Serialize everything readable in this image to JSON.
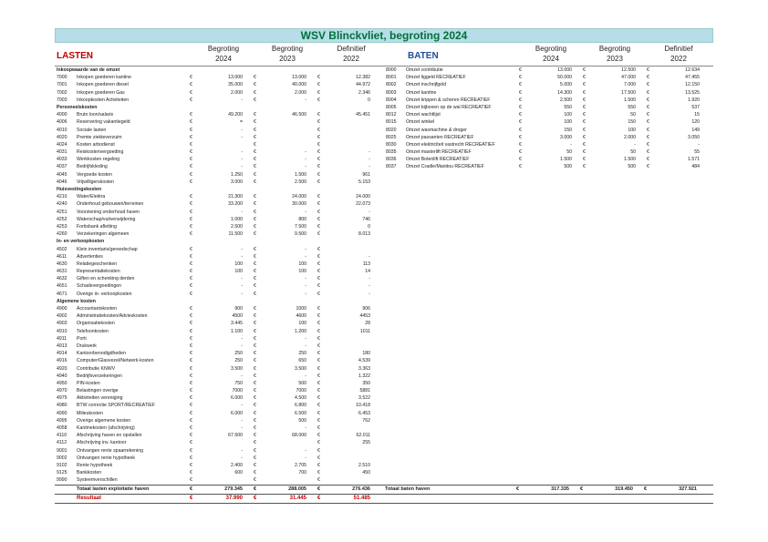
{
  "title": "WSV Blinckvliet, begroting 2024",
  "lasten_header": "LASTEN",
  "baten_header": "BATEN",
  "col_headers": [
    {
      "a": "Begroting",
      "b": "2024"
    },
    {
      "a": "Begroting",
      "b": "2023"
    },
    {
      "a": "Definitief",
      "b": "2022"
    }
  ],
  "euro": "€",
  "lasten": [
    {
      "code": "",
      "label": "Inkoopwaarde van de omzet",
      "cat": true
    },
    {
      "code": "7000",
      "label": "Inkopen goederen kantine",
      "v": [
        "13.000",
        "13.000",
        "12.382"
      ]
    },
    {
      "code": "7001",
      "label": "Inkopen goederen diesel",
      "v": [
        "35.000",
        "40.000",
        "44.972"
      ]
    },
    {
      "code": "7002",
      "label": "Inkopen goederen Gas",
      "v": [
        "2.000",
        "2.000",
        "2.346"
      ]
    },
    {
      "code": "7003",
      "label": "Inkoopkosten Activiteiten",
      "v": [
        "-",
        "-",
        "0"
      ]
    },
    {
      "code": "",
      "label": "Personeelskosten",
      "cat": true
    },
    {
      "code": "4000",
      "label": "Bruto loon/salaris",
      "v": [
        "49.200",
        "46.500",
        "45.451"
      ]
    },
    {
      "code": "4006",
      "label": "Reservering vakantiegeld",
      "v": [
        "=",
        "",
        ""
      ]
    },
    {
      "code": "4010",
      "label": "Sociale lasten",
      "v": [
        "-",
        "",
        ""
      ]
    },
    {
      "code": "4020",
      "label": "Premie ziekteverzuim",
      "v": [
        "-",
        "",
        ""
      ]
    },
    {
      "code": "4024",
      "label": "Kosten arbodienst",
      "v": [
        "",
        "",
        ""
      ]
    },
    {
      "code": "4031",
      "label": "Reiskostenvergoeding",
      "v": [
        "-",
        "-",
        "-"
      ]
    },
    {
      "code": "4033",
      "label": "Werkkosten regeling",
      "v": [
        "-",
        "-",
        "-"
      ]
    },
    {
      "code": "4037",
      "label": "Bedrijfskleding",
      "v": [
        "-",
        "-",
        "-"
      ]
    },
    {
      "code": "4045",
      "label": "Vergoede kosten",
      "v": [
        "1.250",
        "1.500",
        "961"
      ]
    },
    {
      "code": "4046",
      "label": "Vrijwilligerskosten",
      "v": [
        "3.000",
        "2.500",
        "5.153"
      ]
    },
    {
      "code": "",
      "label": "Huisvestingskosten",
      "cat": true
    },
    {
      "code": "4210",
      "label": "Water/Elektra",
      "v": [
        "21.300",
        "24.000",
        "24.000"
      ]
    },
    {
      "code": "4240",
      "label": "Onderhoud gebouwen/terreinen",
      "v": [
        "33.200",
        "30.000",
        "22.073"
      ]
    },
    {
      "code": "4251",
      "label": "Voorziening onderhoud haven",
      "v": [
        "-",
        "-",
        "-"
      ]
    },
    {
      "code": "4252",
      "label": "Waterschap/vuilverwijdering",
      "v": [
        "1.000",
        "800",
        "746"
      ]
    },
    {
      "code": "4253",
      "label": "Fortisbank afletting",
      "v": [
        "2.500",
        "7.500",
        "0"
      ]
    },
    {
      "code": "4260",
      "label": "Verzekeringen algemeen",
      "v": [
        "11.500",
        "9.500",
        "8.013"
      ]
    },
    {
      "code": "",
      "label": "In- en verkoopkosten",
      "cat": true
    },
    {
      "code": "4502",
      "label": "Klein inventaris/gereedschap",
      "v": [
        "-",
        "-",
        ""
      ]
    },
    {
      "code": "4611",
      "label": "Advertenties",
      "v": [
        "-",
        "-",
        "-"
      ]
    },
    {
      "code": "4630",
      "label": "Relatiegeschenken",
      "v": [
        "100",
        "100",
        "113"
      ]
    },
    {
      "code": "4631",
      "label": "Representatiekosten",
      "v": [
        "100",
        "100",
        "14"
      ]
    },
    {
      "code": "4632",
      "label": "Giften en schenking derden",
      "v": [
        "-",
        "-",
        "-"
      ]
    },
    {
      "code": "4651",
      "label": "Schadevergoedingen",
      "v": [
        "-",
        "-",
        "-"
      ]
    },
    {
      "code": "4671",
      "label": "Overige in- verkoopkosten",
      "v": [
        "-",
        "-",
        "-"
      ]
    },
    {
      "code": "",
      "label": "Algemene kosten",
      "cat": true
    },
    {
      "code": "4900",
      "label": "Accountantskosten",
      "v": [
        "900",
        "1000",
        "906"
      ]
    },
    {
      "code": "4902",
      "label": "Administratiekosten/Advieskosten",
      "v": [
        "4500",
        "4600",
        "4453"
      ]
    },
    {
      "code": "4903",
      "label": "Organisatiekosten",
      "v": [
        "3.445",
        "100",
        "28"
      ]
    },
    {
      "code": "4910",
      "label": "Telefoonkosten",
      "v": [
        "1.100",
        "1.200",
        "1011"
      ]
    },
    {
      "code": "4911",
      "label": "Porti",
      "v": [
        "-",
        "-",
        ""
      ]
    },
    {
      "code": "4913",
      "label": "Drukwerk",
      "v": [
        "-",
        "-",
        ""
      ]
    },
    {
      "code": "4914",
      "label": "Kantoorbenodigdheden",
      "v": [
        "250",
        "250",
        "180"
      ]
    },
    {
      "code": "4916",
      "label": "Computer/Glasvezel/Netwerk-kosten",
      "v": [
        "250",
        "650",
        "4.539"
      ]
    },
    {
      "code": "4920",
      "label": "Contributie KNWV",
      "v": [
        "3.500",
        "3.500",
        "3.363"
      ]
    },
    {
      "code": "4940",
      "label": "Bedrijfsverzekeringen",
      "v": [
        "-",
        "-",
        "1.322"
      ]
    },
    {
      "code": "4950",
      "label": "PIN-kosten",
      "v": [
        "750",
        "500",
        "350"
      ]
    },
    {
      "code": "4970",
      "label": "Belastingen overige",
      "v": [
        "7000",
        "7000",
        "5881"
      ]
    },
    {
      "code": "4975",
      "label": "Aktiviteiten vereniging",
      "v": [
        "6.000",
        "4.500",
        "3.522"
      ]
    },
    {
      "code": "4980",
      "label": "BTW correctie SPORT/RECREATIEF",
      "v": [
        "-",
        "6.800",
        "10.418"
      ]
    },
    {
      "code": "4990",
      "label": "Milieukosten",
      "v": [
        "6.000",
        "6.500",
        "6.453"
      ]
    },
    {
      "code": "4995",
      "label": "Overige algemene kosten",
      "v": [
        "-",
        "500",
        "762"
      ]
    },
    {
      "code": "4058",
      "label": "Kantinekosten (afschrijving)",
      "v": [
        "-",
        "-",
        ""
      ]
    },
    {
      "code": "4110",
      "label": "Afschrijving haven en opstallen",
      "v": [
        "67.500",
        "68.000",
        "62.011"
      ]
    },
    {
      "code": "4112",
      "label": "Afschrijving inv. kantoor",
      "v": [
        "",
        "",
        "255"
      ]
    },
    {
      "code": "9001",
      "label": "Ontvangen rente spaarrekening",
      "v": [
        "-",
        "-",
        ""
      ]
    },
    {
      "code": "9002",
      "label": "Ontvangen rente hypotheek",
      "v": [
        "-",
        "-",
        ""
      ]
    },
    {
      "code": "9102",
      "label": "Rente hypotheek",
      "v": [
        "2.400",
        "2.705",
        "2.510"
      ]
    },
    {
      "code": "9125",
      "label": "Bankkosten",
      "v": [
        "600",
        "700",
        "450"
      ]
    },
    {
      "code": "9990",
      "label": "Systeemverschillen",
      "v": [
        "",
        "",
        ""
      ]
    }
  ],
  "baten": [
    {
      "code": "8000",
      "label": "Omzet contributie",
      "v": [
        "13.000",
        "12.500",
        "12.634"
      ]
    },
    {
      "code": "8001",
      "label": "Omzet liggeld RECREATIEF",
      "v": [
        "50.000",
        "47.000",
        "47.455"
      ]
    },
    {
      "code": "8002",
      "label": "Omzet inschrijfgeld",
      "v": [
        "5.000",
        "7.000",
        "12.150"
      ]
    },
    {
      "code": "8003",
      "label": "Omzet kantine",
      "v": [
        "14.300",
        "17.500",
        "13.525"
      ]
    },
    {
      "code": "8004",
      "label": "Omzet krippen & scheren RECREATIEF",
      "v": [
        "2.500",
        "1.500",
        "1.920"
      ]
    },
    {
      "code": "8005",
      "label": "Omzet bijboxen op de wal RECREATIEF",
      "v": [
        "550",
        "550",
        "537"
      ]
    },
    {
      "code": "8012",
      "label": "Omzet wachtlijst",
      "v": [
        "100",
        "50",
        "15"
      ]
    },
    {
      "code": "8015",
      "label": "Omzet winkel",
      "v": [
        "100",
        "150",
        "120"
      ]
    },
    {
      "code": "8020",
      "label": "Omzet wasmachine & droger",
      "v": [
        "150",
        "100",
        "149"
      ]
    },
    {
      "code": "8025",
      "label": "Omzet passanten RECREATIEF",
      "v": [
        "3.000",
        "2.000",
        "3.050"
      ]
    },
    {
      "code": "8030",
      "label": "Omzet elektriciteit vastrecht RECREATIEF",
      "v": [
        "-",
        "-",
        "-"
      ]
    },
    {
      "code": "8035",
      "label": "Omzet masterlift RECREATIEF",
      "v": [
        "50",
        "50",
        "55"
      ]
    },
    {
      "code": "8036",
      "label": "Omzet Botenlift RECREATIEF",
      "v": [
        "1.500",
        "1.500",
        "1.571"
      ]
    },
    {
      "code": "8037",
      "label": "Omzet Cradle/Manitou RECREATIEF",
      "v": [
        "500",
        "500",
        "484"
      ]
    }
  ],
  "totals": {
    "label": "Totaal lasten exploitatie haven",
    "v": [
      "279.345",
      "288.005",
      "276.436"
    ],
    "baten_label": "Totaal baten haven",
    "bv": [
      "317.335",
      "319.450",
      "327.921"
    ]
  },
  "result": {
    "label": "Resultaat",
    "v": [
      "37.990",
      "31.445",
      "51.485"
    ]
  }
}
